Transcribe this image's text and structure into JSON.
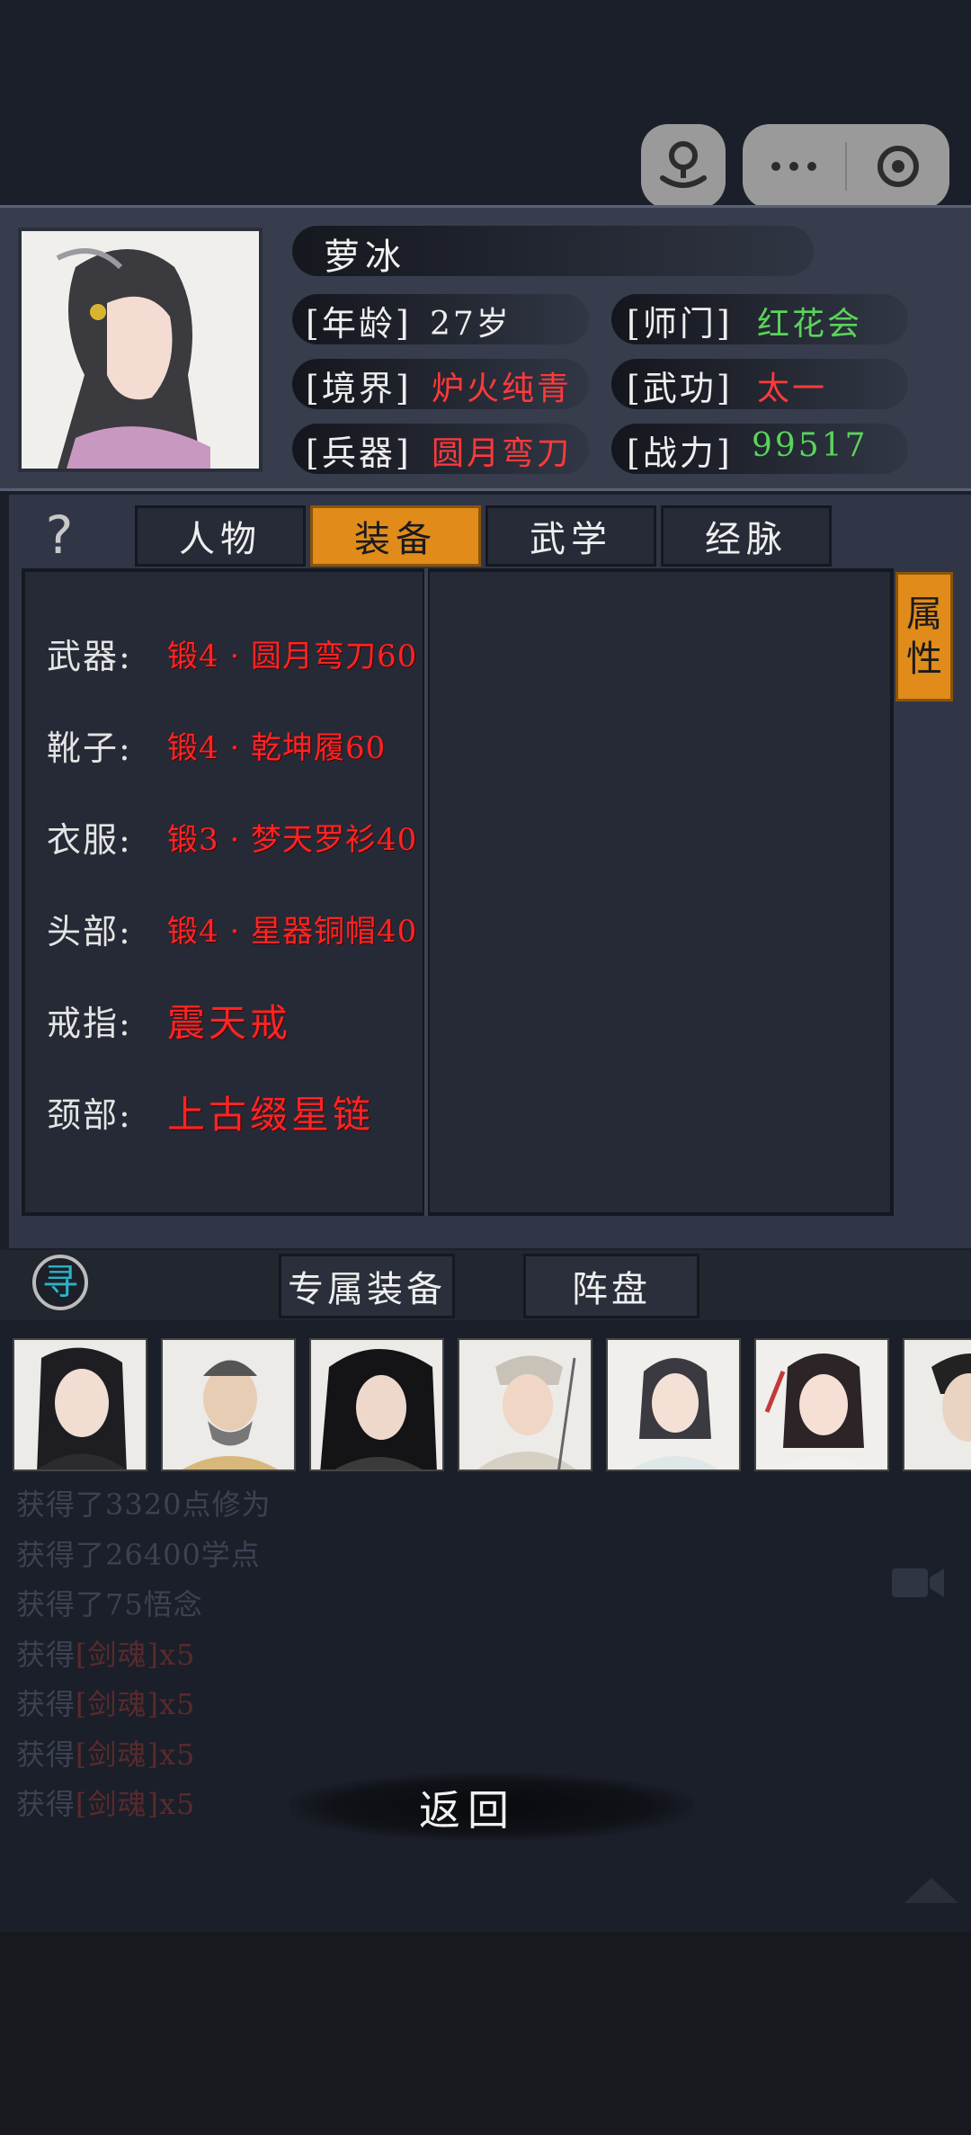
{
  "profile": {
    "name": "萝冰",
    "rows": [
      {
        "label": "[年龄]",
        "value": "27岁",
        "color": "white"
      },
      {
        "label": "[师门]",
        "value": "红花会",
        "color": "green"
      },
      {
        "label": "[境界]",
        "value": "炉火纯青",
        "color": "red"
      },
      {
        "label": "[武功]",
        "value": "太一",
        "color": "red"
      },
      {
        "label": "[兵器]",
        "value": "圆月弯刀",
        "color": "red"
      },
      {
        "label": "[战力]",
        "value": "99517",
        "color": "green"
      }
    ]
  },
  "tabs": {
    "help": "?",
    "items": [
      "人物",
      "装备",
      "武学",
      "经脉"
    ],
    "active": "装备"
  },
  "attr_button": [
    "属",
    "性"
  ],
  "equipment": [
    {
      "label": "武器:",
      "value": "锻4 · 圆月弯刀60"
    },
    {
      "label": "靴子:",
      "value": "锻4 · 乾坤履60"
    },
    {
      "label": "衣服:",
      "value": "锻3 · 梦天罗衫40"
    },
    {
      "label": "头部:",
      "value": "锻4 · 星器铜帽40"
    },
    {
      "label": "戒指:",
      "value": "震天戒"
    },
    {
      "label": "颈部:",
      "value": "上古缀星链"
    }
  ],
  "sub_tabs": {
    "seek": "寻",
    "exclusive": "专属装备",
    "formation": "阵盘"
  },
  "log": [
    {
      "prefix": "获得了3320点修为",
      "item": ""
    },
    {
      "prefix": "获得了26400学点",
      "item": ""
    },
    {
      "prefix": "获得了75悟念",
      "item": ""
    },
    {
      "prefix": "获得",
      "item": "[剑魂]x5"
    },
    {
      "prefix": "获得",
      "item": "[剑魂]x5"
    },
    {
      "prefix": "获得",
      "item": "[剑魂]x5"
    },
    {
      "prefix": "获得",
      "item": "[剑魂]x5"
    }
  ],
  "back_label": "返回",
  "colors": {
    "accent": "#e08b1a",
    "red": "#ff3a3a",
    "green": "#5ad45a"
  }
}
